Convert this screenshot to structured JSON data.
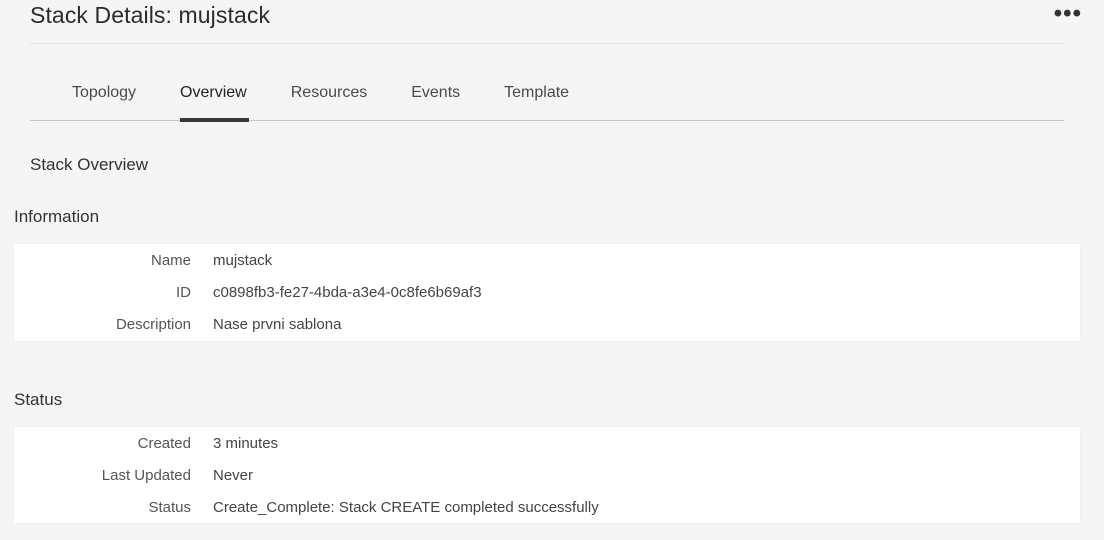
{
  "header": {
    "title": "Stack Details: mujstack",
    "more_label": "•••"
  },
  "tabs": [
    {
      "label": "Topology",
      "active": false
    },
    {
      "label": "Overview",
      "active": true
    },
    {
      "label": "Resources",
      "active": false
    },
    {
      "label": "Events",
      "active": false
    },
    {
      "label": "Template",
      "active": false
    }
  ],
  "overview": {
    "heading": "Stack Overview"
  },
  "information": {
    "heading": "Information",
    "rows": [
      {
        "label": "Name",
        "value": "mujstack"
      },
      {
        "label": "ID",
        "value": "c0898fb3-fe27-4bda-a3e4-0c8fe6b69af3"
      },
      {
        "label": "Description",
        "value": "Nase prvni sablona"
      }
    ]
  },
  "status": {
    "heading": "Status",
    "rows": [
      {
        "label": "Created",
        "value": "3 minutes"
      },
      {
        "label": "Last Updated",
        "value": "Never"
      },
      {
        "label": "Status",
        "value": "Create_Complete: Stack CREATE completed successfully"
      }
    ]
  }
}
